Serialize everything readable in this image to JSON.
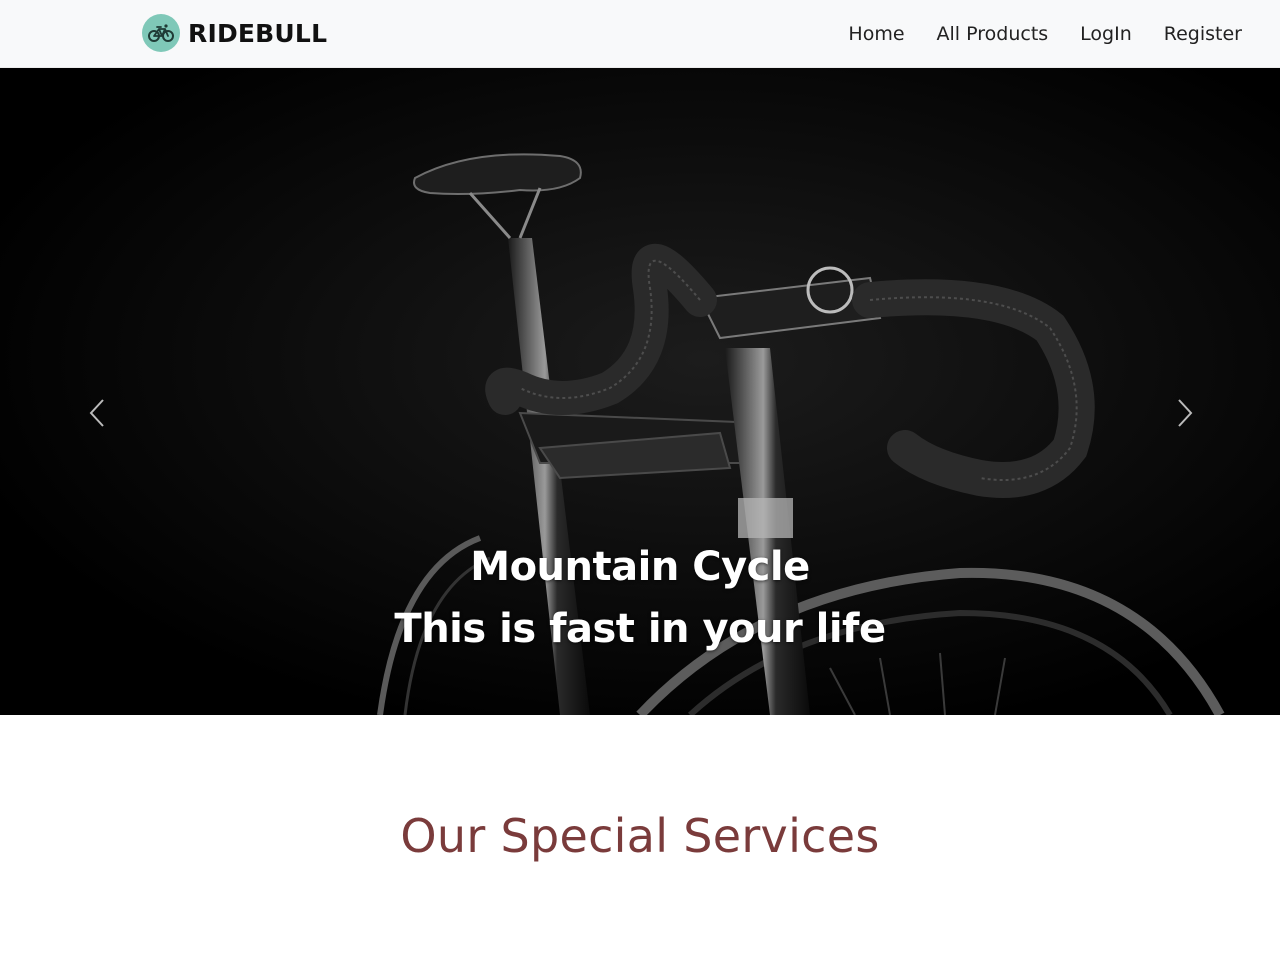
{
  "brand": {
    "name": "RIDEBULL",
    "logo_icon": "bicycle-icon",
    "logo_color": "#7fc8b8"
  },
  "nav": {
    "items": [
      {
        "label": "Home"
      },
      {
        "label": "All Products"
      },
      {
        "label": "LogIn"
      },
      {
        "label": "Register"
      }
    ]
  },
  "hero": {
    "caption_line1": "Mountain Cycle",
    "caption_line2": "This is fast in your life",
    "prev_icon": "chevron-left-icon",
    "next_icon": "chevron-right-icon",
    "image": "bicycle-photo"
  },
  "services": {
    "title": "Our Special Services",
    "title_color": "#7a3b3b"
  }
}
